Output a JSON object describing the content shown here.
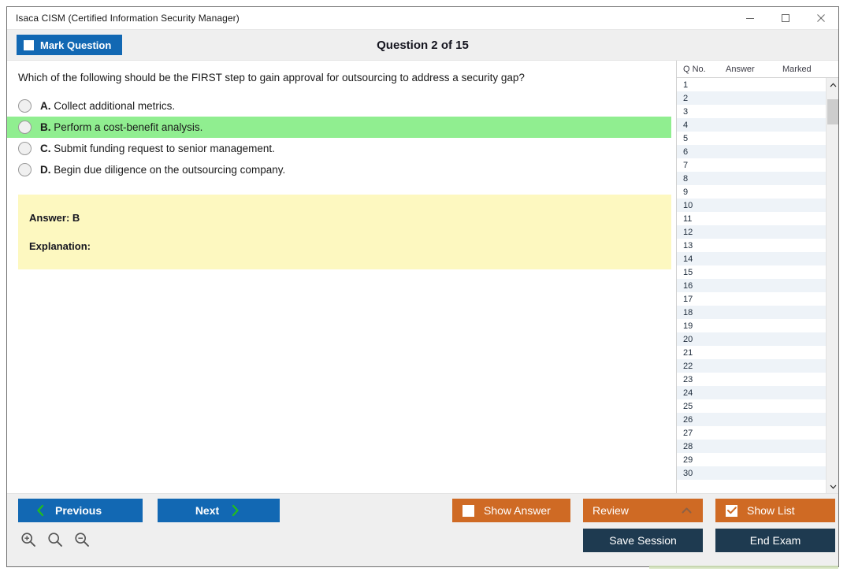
{
  "window": {
    "title": "Isaca CISM (Certified Information Security Manager)",
    "controls": {
      "minimize": "minimize-icon",
      "maximize": "maximize-icon",
      "close": "close-icon"
    }
  },
  "header": {
    "mark_question_label": "Mark Question",
    "mark_question_checked": false,
    "question_counter": "Question 2 of 15"
  },
  "question": {
    "text": "Which of the following should be the FIRST step to gain approval for outsourcing to address a security gap?",
    "options": [
      {
        "letter": "A.",
        "text": "Collect additional metrics.",
        "selected": false,
        "highlight": false
      },
      {
        "letter": "B.",
        "text": "Perform a cost-benefit analysis.",
        "selected": false,
        "highlight": true
      },
      {
        "letter": "C.",
        "text": "Submit funding request to senior management.",
        "selected": false,
        "highlight": false
      },
      {
        "letter": "D.",
        "text": "Begin due diligence on the outsourcing company.",
        "selected": false,
        "highlight": false
      }
    ],
    "answer_label": "Answer: B",
    "explanation_label": "Explanation:"
  },
  "list_panel": {
    "columns": [
      "Q No.",
      "Answer",
      "Marked"
    ],
    "rows": [
      {
        "qno": "1",
        "answer": "",
        "marked": ""
      },
      {
        "qno": "2",
        "answer": "",
        "marked": ""
      },
      {
        "qno": "3",
        "answer": "",
        "marked": ""
      },
      {
        "qno": "4",
        "answer": "",
        "marked": ""
      },
      {
        "qno": "5",
        "answer": "",
        "marked": ""
      },
      {
        "qno": "6",
        "answer": "",
        "marked": ""
      },
      {
        "qno": "7",
        "answer": "",
        "marked": ""
      },
      {
        "qno": "8",
        "answer": "",
        "marked": ""
      },
      {
        "qno": "9",
        "answer": "",
        "marked": ""
      },
      {
        "qno": "10",
        "answer": "",
        "marked": ""
      },
      {
        "qno": "11",
        "answer": "",
        "marked": ""
      },
      {
        "qno": "12",
        "answer": "",
        "marked": ""
      },
      {
        "qno": "13",
        "answer": "",
        "marked": ""
      },
      {
        "qno": "14",
        "answer": "",
        "marked": ""
      },
      {
        "qno": "15",
        "answer": "",
        "marked": ""
      },
      {
        "qno": "16",
        "answer": "",
        "marked": ""
      },
      {
        "qno": "17",
        "answer": "",
        "marked": ""
      },
      {
        "qno": "18",
        "answer": "",
        "marked": ""
      },
      {
        "qno": "19",
        "answer": "",
        "marked": ""
      },
      {
        "qno": "20",
        "answer": "",
        "marked": ""
      },
      {
        "qno": "21",
        "answer": "",
        "marked": ""
      },
      {
        "qno": "22",
        "answer": "",
        "marked": ""
      },
      {
        "qno": "23",
        "answer": "",
        "marked": ""
      },
      {
        "qno": "24",
        "answer": "",
        "marked": ""
      },
      {
        "qno": "25",
        "answer": "",
        "marked": ""
      },
      {
        "qno": "26",
        "answer": "",
        "marked": ""
      },
      {
        "qno": "27",
        "answer": "",
        "marked": ""
      },
      {
        "qno": "28",
        "answer": "",
        "marked": ""
      },
      {
        "qno": "29",
        "answer": "",
        "marked": ""
      },
      {
        "qno": "30",
        "answer": "",
        "marked": ""
      }
    ]
  },
  "footer": {
    "previous_label": "Previous",
    "next_label": "Next",
    "show_answer_label": "Show Answer",
    "show_answer_checked": false,
    "review_label": "Review",
    "show_list_label": "Show List",
    "show_list_checked": true,
    "save_session_label": "Save Session",
    "end_exam_label": "End Exam",
    "zoom_icons": [
      "zoom-in-icon",
      "zoom-reset-icon",
      "zoom-out-icon"
    ]
  },
  "colors": {
    "blue": "#1268b3",
    "orange": "#cf6a24",
    "navy": "#1e3a50",
    "green_highlight": "#90ee90",
    "yellow_answer": "#fdf8c0",
    "chrome_gray": "#efefef",
    "green_arrow": "#22bb22"
  }
}
